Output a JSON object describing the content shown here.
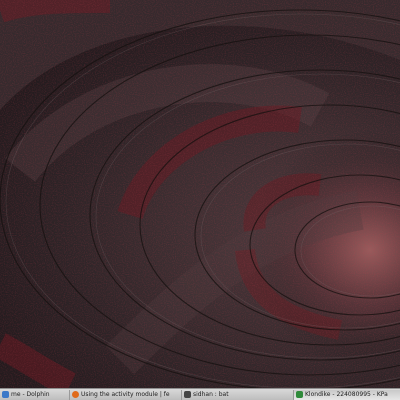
{
  "taskbar": {
    "tasks": [
      {
        "label": "me - Dolphin",
        "icon": "dolphin-icon",
        "icon_color": "#3a78c8"
      },
      {
        "label": "Using the activity module | fe",
        "icon": "firefox-icon",
        "icon_color": "#e06a1a"
      },
      {
        "label": "sidhan : bat",
        "icon": "terminal-icon",
        "icon_color": "#444444"
      },
      {
        "label": "Klondike - 224080995 - KPa",
        "icon": "kpatience-icon",
        "icon_color": "#2f8a3a"
      }
    ]
  },
  "colors": {
    "wallpaper_base": "#2d2427",
    "wallpaper_red": "#7a1a22",
    "taskbar_bg": "#cfcfcf"
  }
}
